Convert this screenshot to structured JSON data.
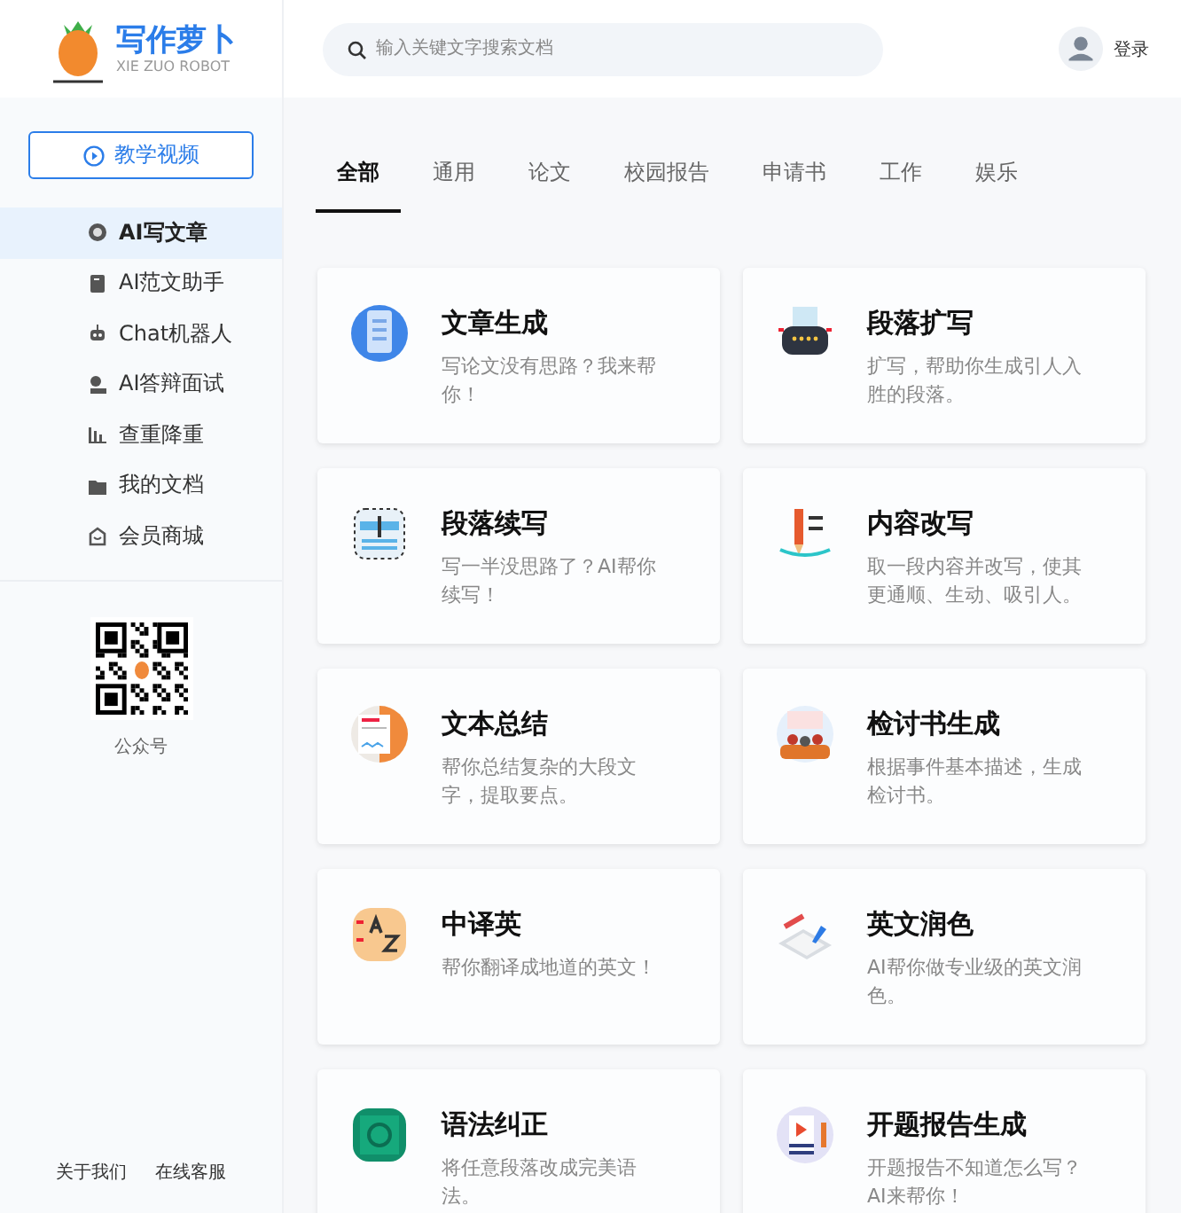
{
  "brand": {
    "name": "写作萝卜",
    "subtitle": "XIE ZUO ROBOT"
  },
  "sidebar": {
    "video_button": "教学视频",
    "items": [
      {
        "label": "AI写文章",
        "selected": true
      },
      {
        "label": "AI范文助手",
        "selected": false
      },
      {
        "label": "Chat机器人",
        "selected": false
      },
      {
        "label": "AI答辩面试",
        "selected": false
      },
      {
        "label": "查重降重",
        "selected": false
      },
      {
        "label": "我的文档",
        "selected": false
      },
      {
        "label": "会员商城",
        "selected": false
      }
    ],
    "qr_caption": "公众号",
    "footer_links": [
      "关于我们",
      "在线客服"
    ]
  },
  "search": {
    "placeholder": "输入关键文字搜索文档"
  },
  "login": "登录",
  "tabs": [
    {
      "label": "全部",
      "selected": true
    },
    {
      "label": "通用",
      "selected": false
    },
    {
      "label": "论文",
      "selected": false
    },
    {
      "label": "校园报告",
      "selected": false
    },
    {
      "label": "申请书",
      "selected": false
    },
    {
      "label": "工作",
      "selected": false
    },
    {
      "label": "娱乐",
      "selected": false
    }
  ],
  "cards": [
    {
      "title": "文章生成",
      "description": "写论文没有思路？我来帮你！"
    },
    {
      "title": "段落扩写",
      "description": "扩写，帮助你生成引人入胜的段落。"
    },
    {
      "title": "段落续写",
      "description": "写一半没思路了？AI帮你续写！"
    },
    {
      "title": "内容改写",
      "description": "取一段内容并改写，使其更通顺、生动、吸引人。"
    },
    {
      "title": "文本总结",
      "description": "帮你总结复杂的大段文字，提取要点。"
    },
    {
      "title": "检讨书生成",
      "description": "根据事件基本描述，生成检讨书。"
    },
    {
      "title": "中译英",
      "description": "帮你翻译成地道的英文！"
    },
    {
      "title": "英文润色",
      "description": "AI帮你做专业级的英文润色。"
    },
    {
      "title": "语法纠正",
      "description": "将任意段落改成完美语法。"
    },
    {
      "title": "开题报告生成",
      "description": "开题报告不知道怎么写？AI来帮你！"
    }
  ]
}
